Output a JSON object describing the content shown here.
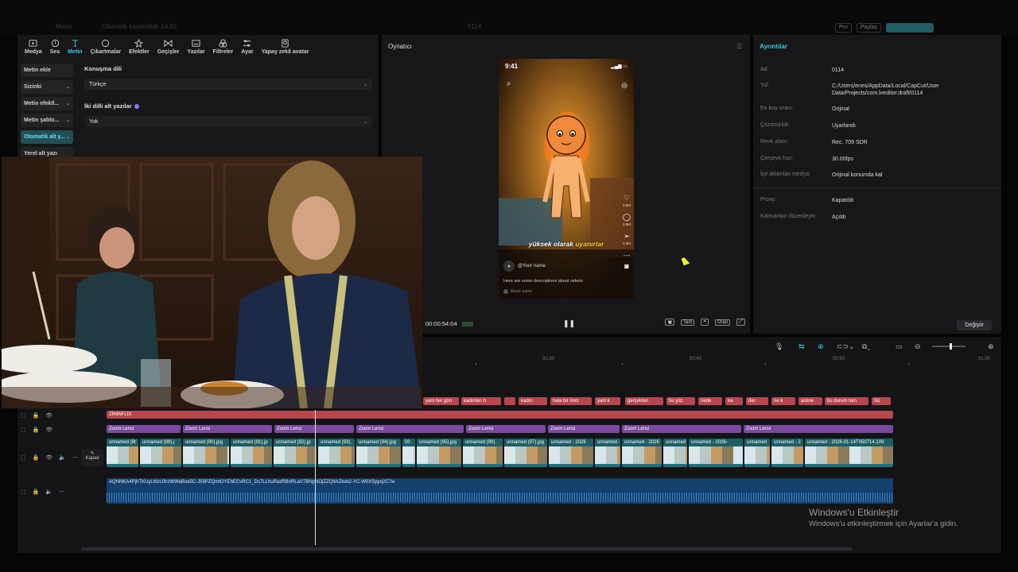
{
  "topbar": {
    "ghost_left": "Menü",
    "ghost_project": "Otomatik kaydedildi: 14:55",
    "ghost_center": "0114",
    "pills": [
      "Pro",
      "Paylaş"
    ]
  },
  "toolbar": {
    "items": [
      {
        "label": "Medya",
        "icon": "media-icon"
      },
      {
        "label": "Ses",
        "icon": "audio-icon"
      },
      {
        "label": "Metin",
        "icon": "text-icon",
        "active": true
      },
      {
        "label": "Çıkartmalar",
        "icon": "sticker-icon"
      },
      {
        "label": "Efektler",
        "icon": "effects-icon"
      },
      {
        "label": "Geçişler",
        "icon": "transitions-icon"
      },
      {
        "label": "Yazılar",
        "icon": "captions-icon"
      },
      {
        "label": "Filtreler",
        "icon": "filters-icon"
      },
      {
        "label": "Ayar",
        "icon": "adjust-icon"
      },
      {
        "label": "Yapay zekâ avatar",
        "icon": "ai-avatar-icon"
      }
    ]
  },
  "categories": [
    {
      "label": "Metin ekle",
      "chevron": false
    },
    {
      "label": "Sizinki",
      "chevron": true
    },
    {
      "label": "Metin efektl...",
      "chevron": true
    },
    {
      "label": "Metin şablo...",
      "chevron": true
    },
    {
      "label": "Otomatik alt y...",
      "chevron": true,
      "active": true
    },
    {
      "label": "Yerel alt yazı",
      "chevron": false
    }
  ],
  "form": {
    "speech_language_label": "Konuşma dili",
    "speech_language_value": "Türkçe",
    "bilingual_label": "İki dilli alt yazılar",
    "bilingual_value": "Yok"
  },
  "player": {
    "title": "Oynatıcı",
    "phone_time": "9:41",
    "caption_a": "yüksek olarak ",
    "caption_b": "uyanırlar",
    "username": "@Your name",
    "description": "Here are some descriptions about videos",
    "music": "Music name",
    "counts": [
      "3.8M",
      "3.8M",
      "3.8M"
    ],
    "timecode": "00:00:54:04",
    "ctrl_labels": [
      "Tam",
      "Oran"
    ]
  },
  "details": {
    "title": "Ayrıntılar",
    "rows": [
      {
        "k": "Ad:",
        "v": "0114"
      },
      {
        "k": "Yol:",
        "v": "C:/Users/enes/AppData/Local/CapCut/User Data/Projects/com.lveditor.draft/0114"
      },
      {
        "k": "En boy oranı:",
        "v": "Orijinal"
      },
      {
        "k": "Çözünürlük:",
        "v": "Uyarlandı"
      },
      {
        "k": "Renk alanı:",
        "v": "Rec. 709 SDR"
      },
      {
        "k": "Çerçeve hızı:",
        "v": "30.00fps"
      },
      {
        "k": "İçe aktarılan medya:",
        "v": "Orijinal konumda kal"
      },
      {
        "k": "Proxy:",
        "v": "Kapatıldı"
      },
      {
        "k": "Katmanları düzenleyin",
        "v": "Açıldı"
      }
    ],
    "button": "Değiştir"
  },
  "timeline": {
    "ruler": [
      "00:30",
      "00:40",
      "00:50",
      "01:00"
    ],
    "text_clips": [
      "yani her gün",
      "kadınları h",
      "",
      "kadın",
      "hala bir öncr",
      "yani k",
      "gerçekten",
      "bu yüz",
      "nede",
      "ka",
      "der",
      "ne k",
      "aslıne",
      "bu durum tam",
      "Sü"
    ],
    "ribbon": "ZİHİNFLİX",
    "zoom_clips": [
      "Zoom Lensi",
      "Zoom Lensi",
      "Zoom Lensi",
      "Zoom Lensi",
      "Zoom Lensi",
      "Zoom Lensi",
      "Zoom Lensi",
      "Zoom Lensi"
    ],
    "video_clips": [
      "unnamed (8t",
      "unnamed (89).j",
      "unnamed (90).jpg",
      "unnamed (91).jp",
      "unnamed (92).jp",
      "unnamed (93).",
      "unnamed (94).jpg",
      "00",
      "unnamed (95).jpg",
      "unnamed (99).",
      "unnamed (97).jpg",
      "unnamed - 2026",
      "unnamed -",
      "unnamed - 2026",
      "unnamed -",
      "unnamed - 2026-",
      "unnamed",
      "unnamed - 2",
      "unnamed - 2026-01-14T050714.109"
    ],
    "cover_label": "Kapak",
    "audio_name": "AQNNKA4PjhTKUyLfdzU3rzWWeBoe5C-J59PZQmtOYEhECvRC1_Ds7LLhuRazRBnRLaV7BNpNOjZZQ8AZkvb2-YC-W0XSpyq2C7w"
  },
  "watermark": {
    "line1": "Windows'u Etkinleştir",
    "line2": "Windows'u etkinleştirmek için Ayarlar'a gidin."
  }
}
